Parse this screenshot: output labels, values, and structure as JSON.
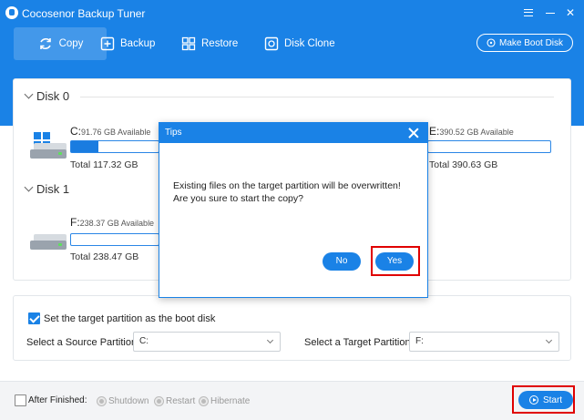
{
  "app": {
    "title": "Cocosenor Backup Tuner"
  },
  "toolbar": {
    "copy": "Copy",
    "backup": "Backup",
    "restore": "Restore",
    "disk_clone": "Disk Clone",
    "make_boot_disk": "Make Boot Disk"
  },
  "disks": [
    {
      "label": "Disk 0",
      "partitions": [
        {
          "letter": "C:",
          "available": "91.76 GB Available",
          "total": "Total 117.32 GB",
          "used_fraction": 0.22
        },
        {
          "letter": "E:",
          "available": "390.52 GB Available",
          "total": "Total 390.63 GB",
          "used_fraction": 0.0
        }
      ]
    },
    {
      "label": "Disk 1",
      "partitions": [
        {
          "letter": "F:",
          "available": "238.37 GB Available",
          "total": "Total 238.47 GB",
          "used_fraction": 0.0
        }
      ]
    }
  ],
  "options": {
    "boot_checkbox_label": "Set the target partition as the boot disk",
    "boot_checked": true,
    "source_label": "Select a Source Partition:",
    "source_value": "C:",
    "target_label": "Select a Target Partition:",
    "target_value": "F:"
  },
  "bottom": {
    "after_finished": "After Finished:",
    "shutdown": "Shutdown",
    "restart": "Restart",
    "hibernate": "Hibernate",
    "start": "Start"
  },
  "dialog": {
    "title": "Tips",
    "line1": "Existing files on the target partition will be overwritten!",
    "line2": "Are you sure to start the copy?",
    "no": "No",
    "yes": "Yes"
  },
  "colors": {
    "accent": "#1a82e6",
    "highlight": "#e00000"
  }
}
